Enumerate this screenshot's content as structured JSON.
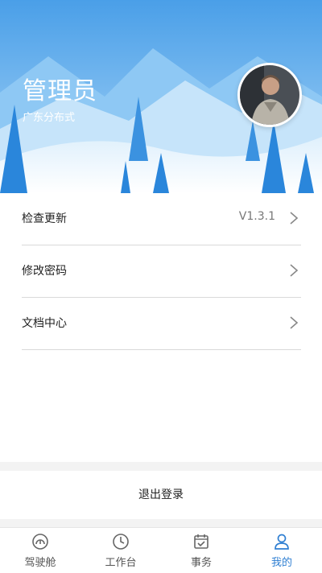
{
  "profile": {
    "name": "管理员",
    "org": "广东分布式"
  },
  "menu": {
    "items": [
      {
        "label": "检查更新",
        "value": "V1.3.1"
      },
      {
        "label": "修改密码",
        "value": ""
      },
      {
        "label": "文档中心",
        "value": ""
      }
    ]
  },
  "logout_label": "退出登录",
  "tabbar": {
    "tabs": [
      {
        "label": "驾驶舱",
        "icon": "dashboard-icon"
      },
      {
        "label": "工作台",
        "icon": "clock-icon"
      },
      {
        "label": "事务",
        "icon": "calendar-check-icon"
      },
      {
        "label": "我的",
        "icon": "user-icon"
      }
    ],
    "active_index": 3
  },
  "colors": {
    "accent": "#2f7fd2",
    "header_sky": "#6db5ef",
    "header_snow": "#eef6fd"
  }
}
